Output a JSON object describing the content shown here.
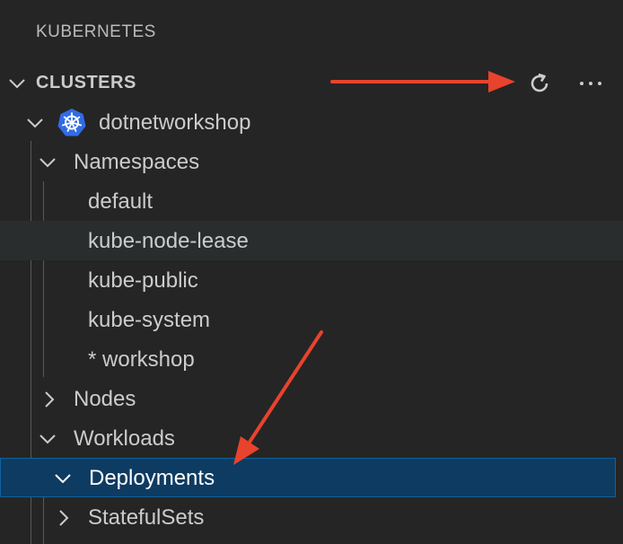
{
  "panel": {
    "title": "KUBERNETES"
  },
  "section": {
    "title": "CLUSTERS"
  },
  "toolbar": {
    "refresh_icon": "refresh-icon",
    "more_icon": "ellipsis-icon"
  },
  "tree": {
    "cluster": {
      "label": "dotnetworkshop",
      "icon": "kubernetes-icon"
    },
    "namespaces": {
      "label": "Namespaces",
      "items": [
        "default",
        "kube-node-lease",
        "kube-public",
        "kube-system",
        "* workshop"
      ]
    },
    "nodes": {
      "label": "Nodes"
    },
    "workloads": {
      "label": "Workloads",
      "deployments": "Deployments",
      "statefulsets": "StatefulSets"
    }
  },
  "colors": {
    "background": "#252526",
    "selection": "#0e3b61",
    "hover": "#2a2d2e",
    "arrow": "#e8432c",
    "kubernetes_blue": "#326ce5"
  }
}
